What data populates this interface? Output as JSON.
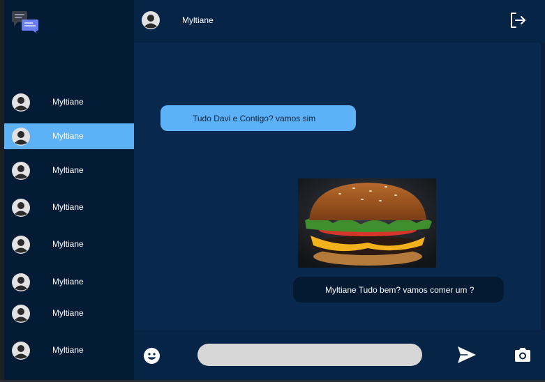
{
  "header": {
    "contact_name": "Myltiane"
  },
  "sidebar": {
    "contacts": [
      {
        "name": "Myltiane",
        "active": false
      },
      {
        "name": "Myltiane",
        "active": true
      },
      {
        "name": "Myltiane",
        "active": false
      },
      {
        "name": "Myltiane",
        "active": false
      },
      {
        "name": "Myltiane",
        "active": false
      },
      {
        "name": "Myltiane",
        "active": false
      },
      {
        "name": "Myltiane",
        "active": false
      },
      {
        "name": "Myltiane",
        "active": false
      }
    ]
  },
  "messages": {
    "incoming_text": "Tudo Davi e Contigo? vamos sim",
    "outgoing_text": "Myltiane Tudo bem?  vamos comer um ?"
  },
  "composer": {
    "placeholder": ""
  },
  "icons": {
    "logo": "chat-bubbles-logo-icon",
    "avatar": "user-avatar-icon",
    "logout": "logout-icon",
    "emoji": "smiley-icon",
    "send": "send-icon",
    "camera": "camera-icon"
  },
  "colors": {
    "sidebar_bg": "#041b35",
    "header_bg": "#062445",
    "chat_bg": "#08294d",
    "accent": "#5cb1f7",
    "outgoing_bubble": "#041a33",
    "input_bg": "#d7d7d7"
  }
}
